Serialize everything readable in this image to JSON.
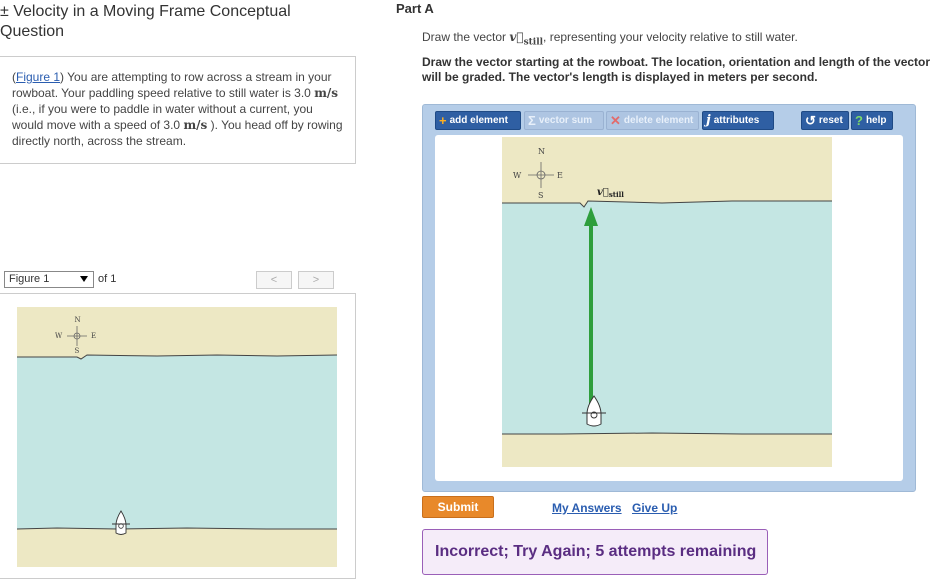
{
  "left": {
    "title": "± Velocity in a Moving Frame Conceptual Question",
    "intro": {
      "figure_link": "Figure 1",
      "text_a": " You are attempting to row across a stream in your rowboat. Your paddling speed relative to still water is 3.0 ",
      "unit1": "m/s",
      "text_b": " (i.e., if you were to paddle in water without a current, you would move with a speed of 3.0 ",
      "unit2": "m/s",
      "text_c": " ). You head off by rowing directly north, across the stream."
    },
    "figure_nav": {
      "selected": "Figure 1",
      "of_label": "of 1",
      "prev": "<",
      "next": ">"
    }
  },
  "compass": {
    "n": "N",
    "s": "S",
    "e": "E",
    "w": "W"
  },
  "right": {
    "part": "Part A",
    "instr1_a": "Draw the vector ",
    "instr1_vec": "v⃗",
    "instr1_sub": "still",
    "instr1_b": ", representing your velocity relative to still water.",
    "instr2": "Draw the vector starting at the rowboat. The location, orientation and length of the vector will be graded. The vector's length is displayed in meters per second.",
    "toolbar": {
      "add": "add element",
      "sum": "vector sum",
      "del": "delete element",
      "attr": "attributes",
      "reset": "reset",
      "help": "help"
    },
    "vector_label_v": "v⃗",
    "vector_label_sub": "still",
    "submit": "Submit",
    "my_answers": "My Answers",
    "give_up": "Give Up",
    "feedback": "Incorrect; Try Again; 5 attempts remaining"
  },
  "colors": {
    "bank": "#ede8c4",
    "water": "#c4e6e3",
    "vector": "#2e9e3c",
    "accent": "#2f5fa3",
    "submit": "#e8892a",
    "feedback_text": "#5a2d82"
  }
}
